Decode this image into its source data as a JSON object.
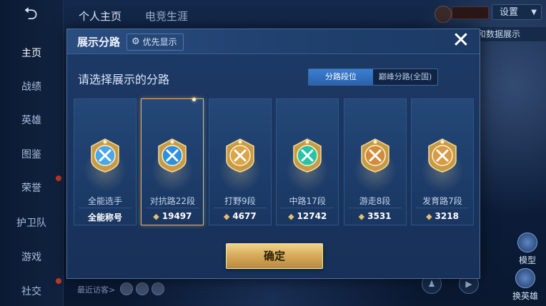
{
  "background": {
    "top_tabs": [
      "个人主页",
      "电竞生涯"
    ],
    "settings_label": "设置",
    "data_show_label": "和数据展示",
    "nav_items": [
      "主页",
      "战绩",
      "英雄",
      "图鉴",
      "荣誉",
      "护卫队",
      "游戏",
      "社交"
    ],
    "recent_visitors_label": "最近访客>",
    "side_buttons": [
      "模型",
      "换英雄"
    ]
  },
  "modal": {
    "title": "展示分路",
    "priority_label": "优先显示",
    "close_glyph": "✕",
    "prompt": "请选择展示的分路",
    "segmented": [
      "分路段位",
      "巅峰分路(全国)"
    ],
    "cards": [
      {
        "name": "全能选手",
        "score": "全能称号",
        "emblem_color": "#4aa6e8",
        "selected": false
      },
      {
        "name": "对抗路22段",
        "score": "19497",
        "emblem_color": "#2d8fe0",
        "selected": true
      },
      {
        "name": "打野9段",
        "score": "4677",
        "emblem_color": "#d9a44a",
        "selected": false
      },
      {
        "name": "中路17段",
        "score": "12742",
        "emblem_color": "#23c5a4",
        "selected": false
      },
      {
        "name": "游走8段",
        "score": "3531",
        "emblem_color": "#d08c3c",
        "selected": false
      },
      {
        "name": "发育路7段",
        "score": "3218",
        "emblem_color": "#d89a45",
        "selected": false
      }
    ],
    "confirm_label": "确定"
  }
}
